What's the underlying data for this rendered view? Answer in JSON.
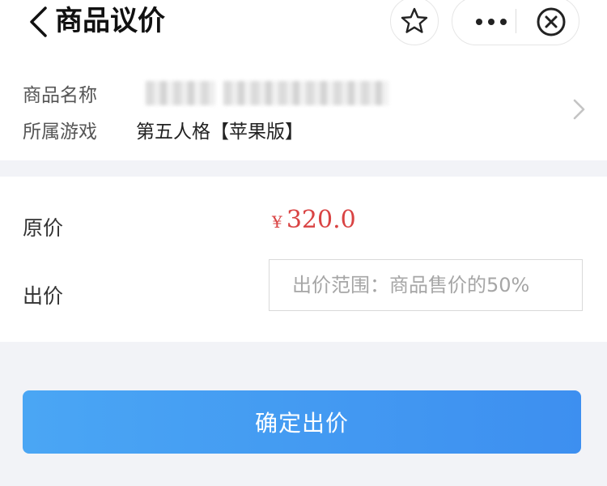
{
  "header": {
    "title": "商品议价"
  },
  "product": {
    "name_label": "商品名称",
    "game_label": "所属游戏",
    "game_value": "第五人格【苹果版】"
  },
  "price": {
    "original_label": "原价",
    "currency_symbol": "¥",
    "original_amount": "320.0",
    "bid_label": "出价",
    "bid_placeholder": "出价范围：商品售价的50%",
    "bid_value": ""
  },
  "actions": {
    "confirm_label": "确定出价"
  },
  "colors": {
    "price": "#d94343",
    "button": "#3d8ff0"
  }
}
